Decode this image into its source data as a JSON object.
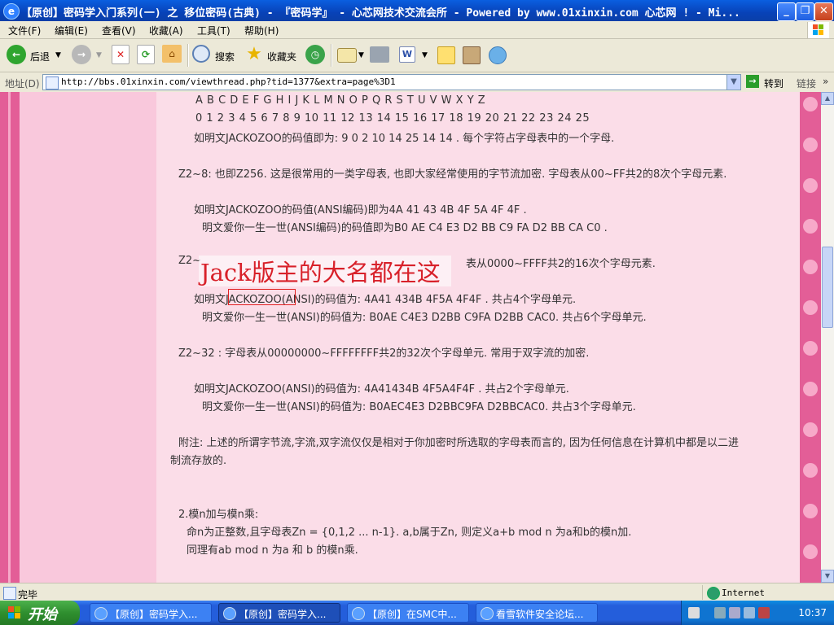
{
  "window": {
    "title": "【原创】密码学入门系列(一) 之 移位密码(古典) - 『密码学』 - 心芯网技术交流会所 - Powered by www.01xinxin.com 心芯网 ! - Mi...",
    "minimize": "_",
    "maximize": "❐",
    "close": "✕"
  },
  "menu": [
    "文件(F)",
    "编辑(E)",
    "查看(V)",
    "收藏(A)",
    "工具(T)",
    "帮助(H)"
  ],
  "toolbar": {
    "back": "后退",
    "search": "搜索",
    "favorites": "收藏夹"
  },
  "address": {
    "label": "地址(D)",
    "url": "http://bbs.01xinxin.com/viewthread.php?tid=1377&extra=page%3D1",
    "go": "转到",
    "links": "链接",
    "more": "»"
  },
  "content": {
    "lines": [
      "A  B  C  D  E  F  G  H  I  J  K  L  M  N  O  P  Q  R  S  T  U  V  W  X  Y  Z",
      "0  1  2  3  4  5  6  7  8  9 10 11 12 13 14 15 16 17 18 19 20 21 22 23 24 25",
      "如明文JACKOZOO的码值即为: 9 0 2 10 14 25 14 14 . 每个字符占字母表中的一个字母.",
      "Z2~8: 也即Z256. 这是很常用的一类字母表, 也即大家经常使用的字节流加密. 字母表从00~FF共2的8次个字母元素.",
      "如明文JACKOZOO的码值(ANSI编码)即为4A 41 43 4B 4F 5A 4F 4F  .",
      "明文爱你一生一世(ANSI编码)的码值即为B0 AE C4 E3 D2 BB C9 FA D2 BB CA C0 .",
      "Z2~",
      "表从0000~FFFF共2的16次个字母元素.",
      "如明文JACKOZOO(ANSI)的码值为: 4A41 434B 4F5A 4F4F . 共占4个字母单元.",
      "明文爱你一生一世(ANSI)的码值为: B0AE C4E3 D2BB C9FA D2BB CAC0. 共占6个字母单元.",
      "Z2~32 : 字母表从00000000~FFFFFFFF共2的32次个字母单元. 常用于双字流的加密.",
      "如明文JACKOZOO(ANSI)的码值为: 4A41434B 4F5A4F4F . 共占2个字母单元.",
      "明文爱你一生一世(ANSI)的码值为: B0AEC4E3 D2BBC9FA D2BBCAC0. 共占3个字母单元.",
      "附注: 上述的所谓字节流,字流,双字流仅仅是相对于你加密时所选取的字母表而言的, 因为任何信息在计算机中都是以二进",
      "制流存放的.",
      "2.模n加与模n乘:",
      "命n为正整数,且字母表Zn = {0,1,2 ... n-1}. a,b属于Zn, 则定义a+b mod n 为a和b的模n加.",
      "同理有ab mod n 为a 和  b 的模n乘."
    ],
    "overlay_annotation": "Jack版主的大名都在这"
  },
  "status": {
    "text": "完毕",
    "zone": "Internet"
  },
  "taskbar": {
    "start": "开始",
    "tasks": [
      "【原创】密码学入...",
      "【原创】密码学入...",
      "【原创】在SMC中...",
      "看雪软件安全论坛..."
    ],
    "clock": "10:37"
  },
  "colors": {
    "content_bg": "#fbdde8",
    "border_pink": "#e35e97",
    "annotation_red": "#d8212a"
  }
}
